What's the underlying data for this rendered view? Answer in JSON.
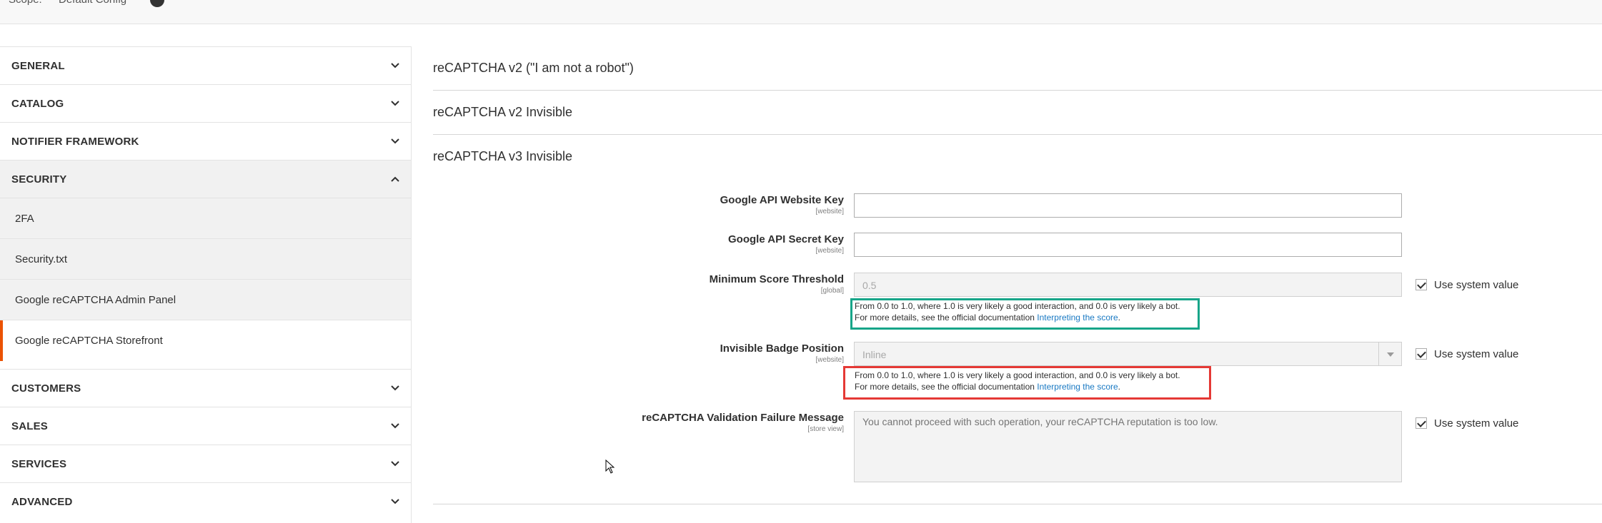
{
  "topbar": {
    "crumb_1": "Scope:",
    "crumb_2": "Default Config"
  },
  "sidebar": {
    "sections_before": [
      {
        "label": "GENERAL"
      },
      {
        "label": "CATALOG"
      },
      {
        "label": "NOTIFIER FRAMEWORK"
      }
    ],
    "open_section": {
      "label": "SECURITY",
      "items": [
        {
          "label": "2FA"
        },
        {
          "label": "Security.txt"
        },
        {
          "label": "Google reCAPTCHA Admin Panel"
        },
        {
          "label": "Google reCAPTCHA Storefront"
        }
      ]
    },
    "sections_after": [
      {
        "label": "CUSTOMERS"
      },
      {
        "label": "SALES"
      },
      {
        "label": "SERVICES"
      },
      {
        "label": "ADVANCED"
      }
    ]
  },
  "main": {
    "groups": [
      {
        "label": "reCAPTCHA v2 (\"I am not a robot\")"
      },
      {
        "label": "reCAPTCHA v2 Invisible"
      },
      {
        "label": "reCAPTCHA v3 Invisible"
      }
    ],
    "fields": {
      "website_key": {
        "label": "Google API Website Key",
        "scope": "[website]",
        "value": ""
      },
      "secret_key": {
        "label": "Google API Secret Key",
        "scope": "[website]",
        "value": ""
      },
      "score_threshold": {
        "label": "Minimum Score Threshold",
        "scope": "[global]",
        "value": "0.5",
        "note_line_1": "From 0.0 to 1.0, where 1.0 is very likely a good interaction, and 0.0 is very likely a bot.",
        "note_line_2": "For more details, see the official documentation",
        "note_link": "Interpreting the score",
        "note_end": "."
      },
      "badge_position": {
        "label": "Invisible Badge Position",
        "scope": "[website]",
        "value": "Inline",
        "note_line_1": "From 0.0 to 1.0, where 1.0 is very likely a good interaction, and 0.0 is very likely a bot.",
        "note_line_2": "For more details, see the official documentation",
        "note_link": "Interpreting the score",
        "note_end": "."
      },
      "failure_message": {
        "label": "reCAPTCHA Validation Failure Message",
        "scope": "[store view]",
        "value": "You cannot proceed with such operation, your reCAPTCHA reputation is too low."
      }
    },
    "use_system_value": "Use system value"
  },
  "colors": {
    "accent": "#eb5202",
    "link": "#1979c3",
    "highlight_green": "#17a589",
    "highlight_red": "#e53935"
  }
}
